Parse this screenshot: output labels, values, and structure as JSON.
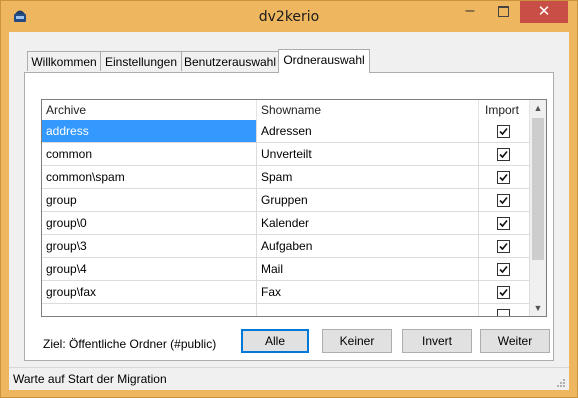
{
  "window": {
    "title": "dv2kerio"
  },
  "titlebar": {
    "minimize": "–",
    "close": "✕"
  },
  "tabs": [
    {
      "label": "Willkommen"
    },
    {
      "label": "Einstellungen"
    },
    {
      "label": "Benutzerauswahl"
    },
    {
      "label": "Ordnerauswahl"
    }
  ],
  "grid": {
    "headers": [
      "Archive",
      "Showname",
      "Import"
    ],
    "rows": [
      {
        "archive": "address",
        "showname": "Adressen",
        "import": true,
        "selected": true
      },
      {
        "archive": "common",
        "showname": "Unverteilt",
        "import": true
      },
      {
        "archive": "common\\spam",
        "showname": "Spam",
        "import": true
      },
      {
        "archive": "group",
        "showname": "Gruppen",
        "import": true
      },
      {
        "archive": "group\\0",
        "showname": "Kalender",
        "import": true
      },
      {
        "archive": "group\\3",
        "showname": "Aufgaben",
        "import": true
      },
      {
        "archive": "group\\4",
        "showname": "Mail",
        "import": true
      },
      {
        "archive": "group\\fax",
        "showname": "Fax",
        "import": true
      }
    ]
  },
  "target_label": "Ziel: Öffentliche Ordner (#public)",
  "buttons": {
    "alle": "Alle",
    "keiner": "Keiner",
    "invert": "Invert",
    "weiter": "Weiter"
  },
  "status": {
    "text": "Warte auf Start der Migration"
  },
  "colors": {
    "titlebar": "#eeb75f",
    "selection": "#3399ff",
    "close": "#c94f46"
  }
}
